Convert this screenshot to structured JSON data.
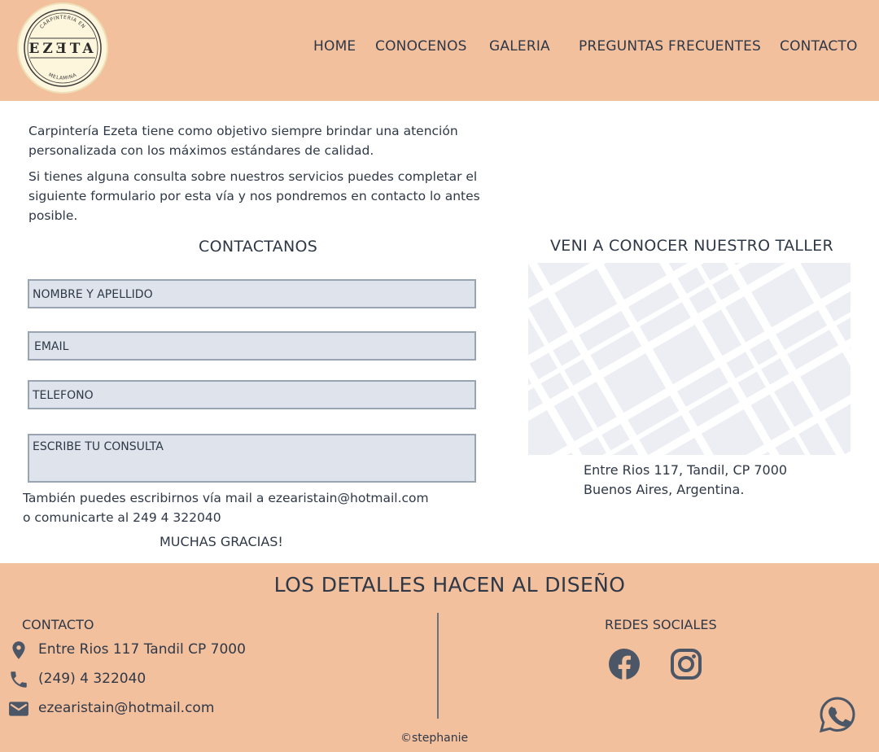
{
  "brand": {
    "logo_top_text": "CARPINTERIA EN",
    "logo_main_text": "EZƎTA",
    "logo_bottom_text": "MELAMINA"
  },
  "nav": {
    "items": [
      {
        "label": "HOME"
      },
      {
        "label": "CONOCENOS"
      },
      {
        "label": "GALERIA"
      },
      {
        "label": "PREGUNTAS FRECUENTES"
      },
      {
        "label": "CONTACTO"
      }
    ]
  },
  "intro": {
    "paragraph1": "Carpintería Ezeta tiene como objetivo siempre brindar una atención personalizada con los máximos estándares de calidad.",
    "paragraph2": "Si tienes alguna consulta sobre nuestros servicios puedes completar el siguiente formulario por esta vía y nos pondremos en contacto lo antes posible."
  },
  "form": {
    "title": "CONTACTANOS",
    "fields": {
      "name": "NOMBRE Y APELLIDO",
      "email": "EMAIL",
      "phone": "TELEFONO",
      "message": "ESCRIBE TU CONSULTA"
    },
    "note_line1": "También puedes escribirnos vía mail a ezearistain@hotmail.com",
    "note_line2": "o comunicarte al 249 4 322040",
    "thanks": "MUCHAS GRACIAS!"
  },
  "workshop": {
    "title": "VENI A CONOCER NUESTRO TALLER",
    "address_line1": "Entre Rios 117, Tandil, CP 7000",
    "address_line2": "Buenos Aires, Argentina."
  },
  "footer": {
    "title": "LOS DETALLES HACEN AL DISEÑO",
    "contact_title": "CONTACTO",
    "address": "Entre Rios 117 Tandil CP 7000",
    "phone": "(249) 4 322040",
    "email": "ezearistain@hotmail.com",
    "social_title": "REDES SOCIALES",
    "copyright": "©stephanie"
  },
  "colors": {
    "header_bg": "#f3c09e",
    "footer_bg": "#f3c09e",
    "text": "#2f3847",
    "field_bg": "#dee3ec",
    "icon": "#4b5666"
  }
}
